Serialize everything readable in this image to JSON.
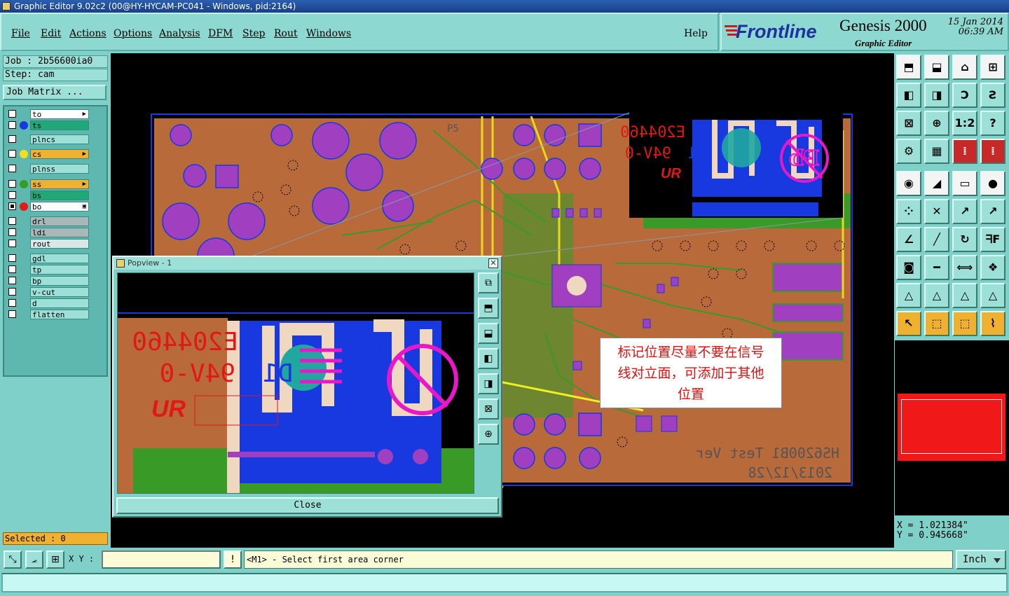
{
  "window": {
    "title": "Graphic Editor 9.02c2 (00@HY-HYCAM-PC041 - Windows, pid:2164)"
  },
  "menu": {
    "items": [
      "File",
      "Edit",
      "Actions",
      "Options",
      "Analysis",
      "DFM",
      "Step",
      "Rout",
      "Windows"
    ],
    "help": "Help"
  },
  "brand": {
    "logo": "Frontline",
    "product": "Genesis 2000",
    "subtitle": "Graphic Editor",
    "date": "15 Jan 2014",
    "time": "06:39 AM"
  },
  "job": {
    "job_label": "Job : 2b56600ia0",
    "step_label": "Step: cam",
    "matrix_button": "Job Matrix ..."
  },
  "layers": [
    {
      "name": "to",
      "color": "#ffffff",
      "checked": false,
      "dot": "",
      "mark": "▶"
    },
    {
      "name": "ts",
      "color": "#20a878",
      "checked": false,
      "dot": "#1838e0",
      "mark": ""
    },
    {
      "name": "plncs",
      "color": "#9de0d8",
      "checked": false,
      "dot": "",
      "mark": ""
    },
    {
      "name": "cs",
      "color": "#f0b030",
      "checked": false,
      "dot": "#f0e020",
      "mark": "▶"
    },
    {
      "name": "plnss",
      "color": "#9de0d8",
      "checked": false,
      "dot": "",
      "mark": ""
    },
    {
      "name": "ss",
      "color": "#f0b030",
      "checked": false,
      "dot": "#30a020",
      "mark": "▶"
    },
    {
      "name": "bs",
      "color": "#20a878",
      "checked": false,
      "dot": "",
      "mark": ""
    },
    {
      "name": "bo",
      "color": "#ffffff",
      "checked": true,
      "dot": "#e81818",
      "mark": "▣"
    },
    {
      "name": "drl",
      "color": "#a8b8b8",
      "checked": false,
      "dot": "",
      "mark": ""
    },
    {
      "name": "ldi",
      "color": "#a8b8b8",
      "checked": false,
      "dot": "",
      "mark": ""
    },
    {
      "name": "rout",
      "color": "#d8e8e8",
      "checked": false,
      "dot": "",
      "mark": ""
    },
    {
      "name": "gdl",
      "color": "#9de0d8",
      "checked": false,
      "dot": "",
      "mark": ""
    },
    {
      "name": "tp",
      "color": "#9de0d8",
      "checked": false,
      "dot": "",
      "mark": ""
    },
    {
      "name": "bp",
      "color": "#9de0d8",
      "checked": false,
      "dot": "",
      "mark": ""
    },
    {
      "name": "v-cut",
      "color": "#9de0d8",
      "checked": false,
      "dot": "",
      "mark": ""
    },
    {
      "name": "d",
      "color": "#9de0d8",
      "checked": false,
      "dot": "",
      "mark": ""
    },
    {
      "name": "flatten",
      "color": "#9de0d8",
      "checked": false,
      "dot": "",
      "mark": ""
    }
  ],
  "selected": "Selected : 0",
  "coords": {
    "x": "X = 1.021384\"",
    "y": "Y = 0.945668\""
  },
  "bottom": {
    "xy_label": "X Y :",
    "xy_value": "",
    "message": "<M1> - Select first area corner",
    "unit": "Inch"
  },
  "popview": {
    "title": "Popview - 1",
    "close": "Close"
  },
  "annotation": {
    "line1": "标记位置尽量不要在信号",
    "line2": "线对立面，可添加于其他",
    "line3": "位置"
  },
  "board_text": {
    "ul": "E204460",
    "grade": "94V-0",
    "d1": "D1",
    "pb": "Pb",
    "ver": "HS6200B1 Test Ver",
    "date": "2013/12/28",
    "p5": "P5",
    "ur": "UR"
  },
  "colors": {
    "board": "#b86a3a",
    "copper": "#3a9a28",
    "pad": "#a040c0",
    "silk": "#e01818",
    "mask": "#1838e0",
    "trace": "#e8d820"
  }
}
